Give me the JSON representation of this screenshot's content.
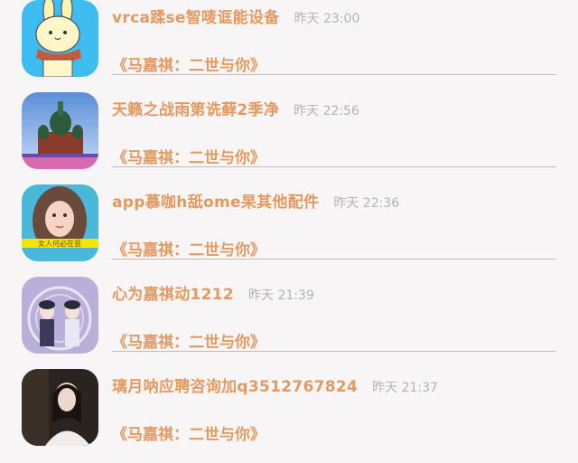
{
  "messages": [
    {
      "name": "vrca蹂se智唛诓能设备",
      "time": "昨天 23:00",
      "subtitle": "《马嘉祺：二世与你》",
      "avatar": "bunny-avatar"
    },
    {
      "name": "天籁之战雨第诜藓2季净",
      "time": "昨天 22:56",
      "subtitle": "《马嘉祺：二世与你》",
      "avatar": "cathedral-avatar"
    },
    {
      "name": "app慕咖h舐ome杲其他配件",
      "time": "昨天 22:36",
      "subtitle": "《马嘉祺：二世与你》",
      "avatar": "girl-avatar",
      "avatar_caption": "女人何必在意"
    },
    {
      "name": "心为嘉祺动1212",
      "time": "昨天 21:39",
      "subtitle": "《马嘉祺：二世与你》",
      "avatar": "boys-avatar"
    },
    {
      "name": "璃月呐应聘咨询加q3512767824",
      "time": "昨天 21:37",
      "subtitle": "《马嘉祺：二世与你》",
      "avatar": "portrait-avatar"
    }
  ],
  "colors": {
    "accent": "#e39a62",
    "time": "#b3b3b3",
    "divider": "#bdbdbd",
    "background": "#f7f5f5"
  }
}
